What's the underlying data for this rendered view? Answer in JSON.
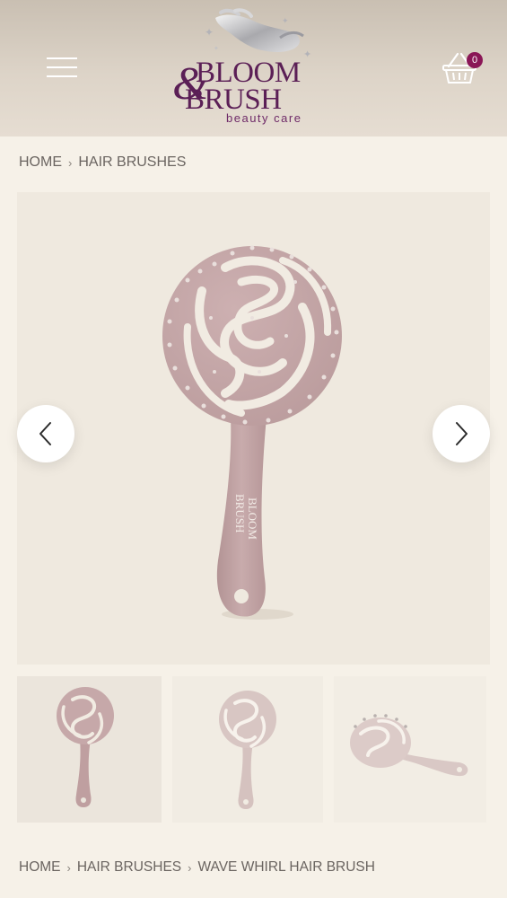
{
  "header": {
    "brand_line1": "BLOOM",
    "brand_line2": "BRUSH",
    "brand_amp": "&",
    "brand_tagline": "beauty care",
    "cart_count": "0",
    "menu_icon": "hamburger-menu-icon",
    "cart_icon": "basket-icon"
  },
  "breadcrumb_top": {
    "items": [
      "HOME",
      "HAIR BRUSHES"
    ]
  },
  "gallery": {
    "prev_icon": "chevron-left-icon",
    "next_icon": "chevron-right-icon",
    "handle_brand_line1": "BLOOM",
    "handle_brand_line2": "BRUSH",
    "thumbnails": 3
  },
  "breadcrumb_bottom": {
    "items": [
      "HOME",
      "HAIR BRUSHES",
      "WAVE WHIRL HAIR BRUSH"
    ]
  },
  "colors": {
    "brand_purple": "#5b1f56",
    "badge": "#8a1656",
    "brush_pink": "#c4a6a7",
    "background": "#f6f1e8"
  }
}
